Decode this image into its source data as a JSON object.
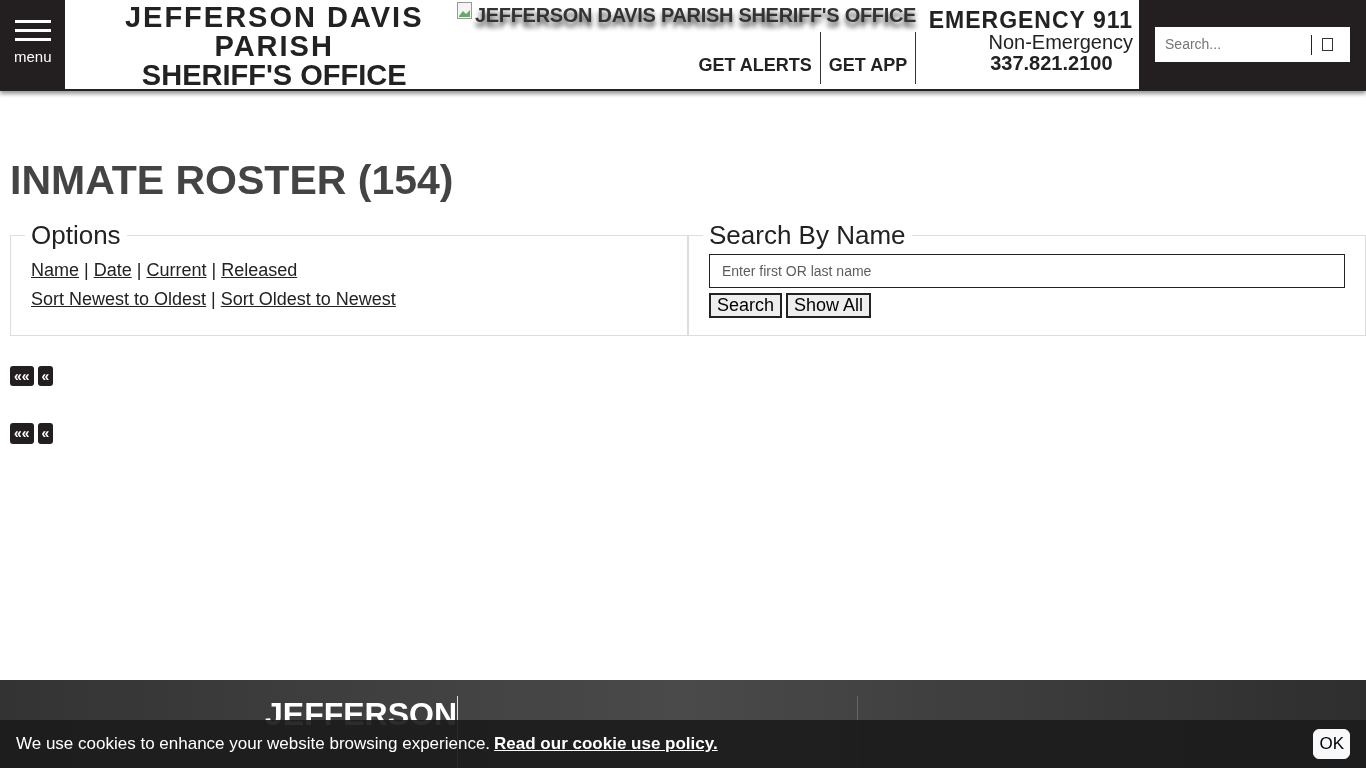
{
  "header": {
    "menu_label": "menu",
    "title_lines": [
      "JEFFERSON DAVIS",
      "PARISH",
      "SHERIFF'S OFFICE"
    ],
    "logo_alt": "JEFFERSON DAVIS PARISH SHERIFF'S OFFICE",
    "links": [
      "GET ALERTS",
      "GET APP"
    ],
    "emergency": "EMERGENCY 911",
    "non_emergency_label": "Non-Emergency",
    "non_emergency_phone": "337.821.2100",
    "search": {
      "placeholder": "Search..."
    }
  },
  "page_title": "INMATE ROSTER (154)",
  "options": {
    "legend": "Options",
    "lines": [
      {
        "items": [
          {
            "kind": "link",
            "text": "Name"
          },
          {
            "kind": "separator",
            "text": "|"
          },
          {
            "kind": "link",
            "text": "Date"
          },
          {
            "kind": "separator",
            "text": "|"
          },
          {
            "kind": "link",
            "text": "Current"
          },
          {
            "kind": "separator",
            "text": "|"
          },
          {
            "kind": "link",
            "text": "Released"
          }
        ]
      },
      {
        "items": [
          {
            "kind": "link",
            "text": "Sort Newest to Oldest"
          },
          {
            "kind": "separator",
            "text": "|"
          },
          {
            "kind": "link",
            "text": "Sort Oldest to Newest"
          }
        ]
      }
    ]
  },
  "search_by_name": {
    "legend": "Search By Name",
    "placeholder": "Enter first OR last name",
    "buttons": [
      "Search",
      "Show All"
    ]
  },
  "pagers": [
    [
      "««",
      "«"
    ],
    [
      "««",
      "«"
    ]
  ],
  "footer": {
    "logo_text": "JEFFERSON"
  },
  "cookie_bar": {
    "text": "We use cookies to enhance your website browsing experience.",
    "link": "Read our cookie use policy.",
    "button": "OK"
  }
}
